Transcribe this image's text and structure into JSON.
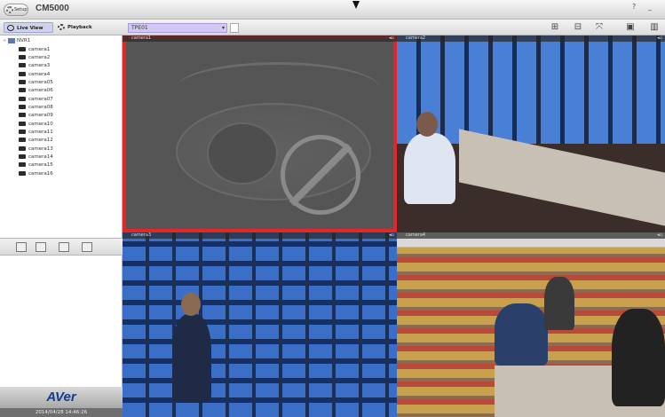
{
  "titlebar": {
    "setup_label": "Setup",
    "app_title": "CM5000",
    "help_label": "?",
    "minimize_label": "_"
  },
  "modes": {
    "live_view_label": "Live View",
    "playback_label": "Playback"
  },
  "group": {
    "selected": "TPE01"
  },
  "tree": {
    "root_label": "NVR1",
    "cameras": [
      "camera1",
      "camera2",
      "camera3",
      "camera4",
      "camera05",
      "camera06",
      "camera07",
      "camera08",
      "camera09",
      "camera10",
      "camera11",
      "camera12",
      "camera13",
      "camera14",
      "camera15",
      "camera16"
    ]
  },
  "tiles": {
    "tile1_label": "camera1",
    "tile2_label": "camera2",
    "tile3_label": "camera3",
    "tile4_label": "camera4"
  },
  "brand": {
    "logo_text": "AVer",
    "datetime": "2014/04/28  14:46:26"
  },
  "colors": {
    "selection": "#e32626",
    "group_select": "#d3c8f3",
    "brand_blue": "#163b8c"
  }
}
